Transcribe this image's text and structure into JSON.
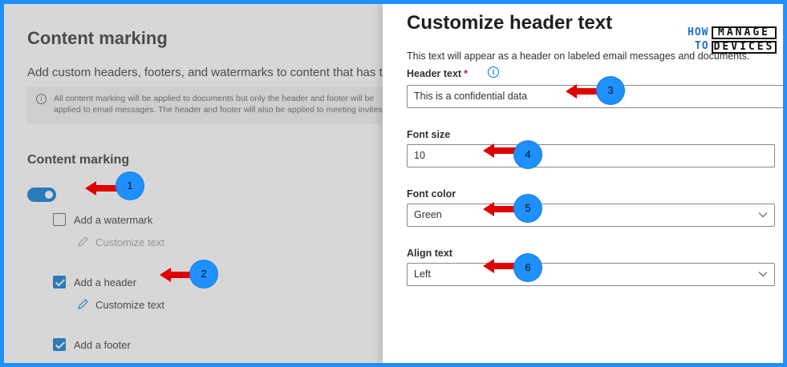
{
  "left_page": {
    "title": "Content marking",
    "description": "Add custom headers, footers, and watermarks to content that has thi",
    "info_text": "All content marking will be applied to documents but only the header and footer will be applied to email messages. The header and footer will also be applied to meeting invites.",
    "section_title": "Content marking",
    "toggle_on": true,
    "options": [
      {
        "label": "Add a watermark",
        "checked": false,
        "customize": "Customize text",
        "customize_enabled": false
      },
      {
        "label": "Add a header",
        "checked": true,
        "customize": "Customize text",
        "customize_enabled": true
      },
      {
        "label": "Add a footer",
        "checked": true
      }
    ]
  },
  "panel": {
    "title": "Customize header text",
    "description": "This text will appear as a header on labeled email messages and documents.",
    "header_text": {
      "label": "Header text",
      "required_mark": "*",
      "value": "This is a confidential data"
    },
    "font_size": {
      "label": "Font size",
      "value": "10"
    },
    "font_color": {
      "label": "Font color",
      "value": "Green"
    },
    "align_text": {
      "label": "Align text",
      "value": "Left"
    }
  },
  "logo": {
    "how": "HOW",
    "to": "TO",
    "manage": "MANAGE",
    "devices": "DEVICES"
  },
  "annotations": [
    "1",
    "2",
    "3",
    "4",
    "5",
    "6"
  ],
  "colors": {
    "accent": "#0078d4",
    "frame": "#1e90ff",
    "arrow": "#e00000",
    "badge": "#1e90ff"
  }
}
